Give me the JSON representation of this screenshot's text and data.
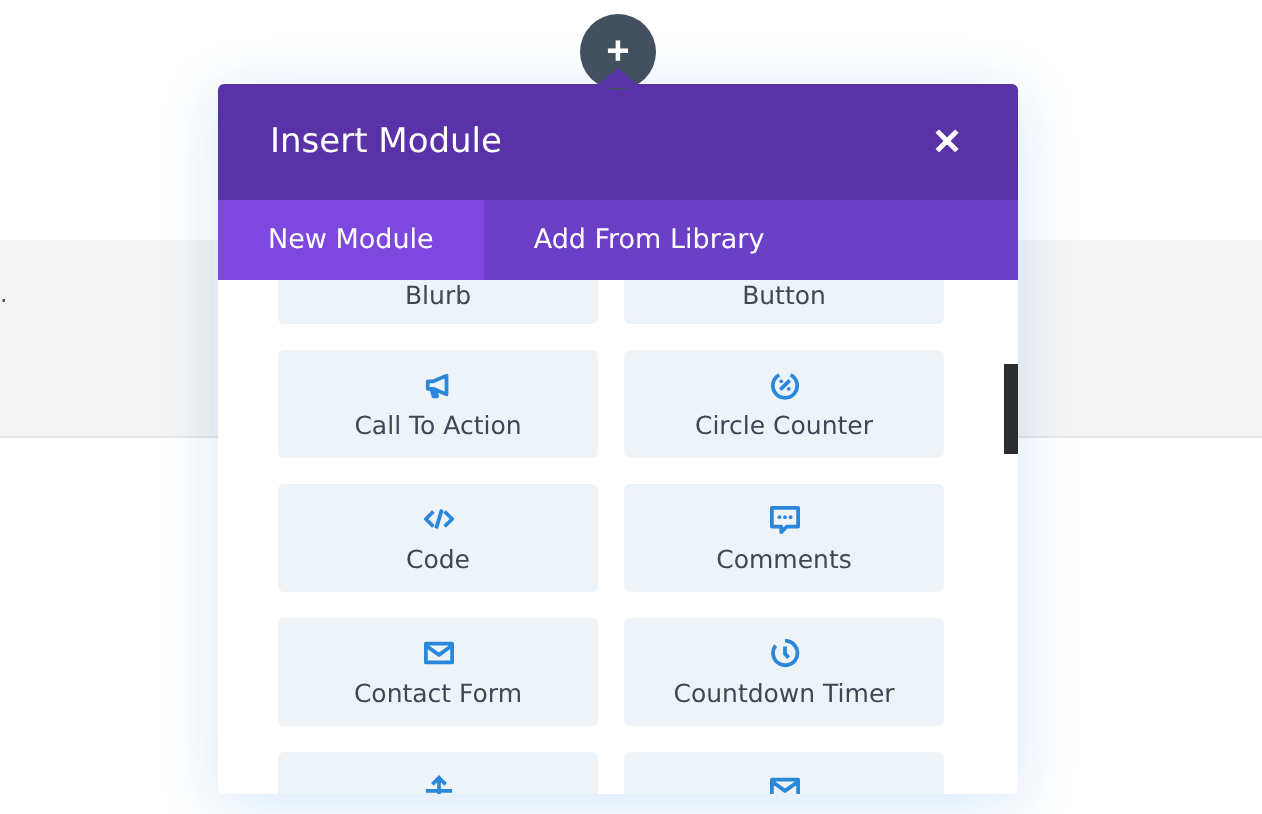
{
  "page": {
    "text_fragment": "."
  },
  "add_button": {
    "label": "+"
  },
  "modal": {
    "title": "Insert Module",
    "close": "✕",
    "tabs": [
      {
        "label": "New Module",
        "selected": true
      },
      {
        "label": "Add From Library",
        "selected": false
      }
    ],
    "modules": [
      {
        "label": "Blurb"
      },
      {
        "label": "Button"
      },
      {
        "label": "Call To Action",
        "kind": "megaphone"
      },
      {
        "label": "Circle Counter",
        "kind": "counter"
      },
      {
        "label": "Code",
        "kind": "code"
      },
      {
        "label": "Comments",
        "kind": "comment"
      },
      {
        "label": "Contact Form",
        "kind": "mail"
      },
      {
        "label": "Countdown Timer",
        "kind": "timer"
      },
      {
        "kind": "divider"
      },
      {
        "kind": "mail"
      }
    ]
  }
}
